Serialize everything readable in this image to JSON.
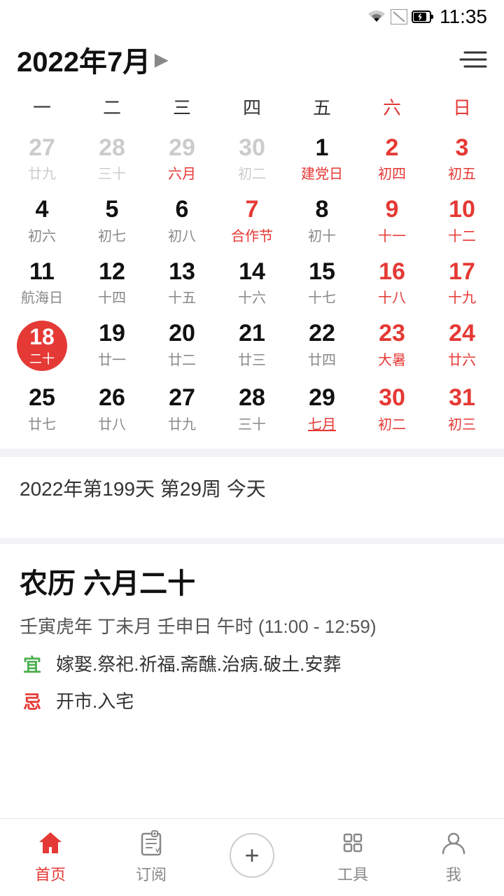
{
  "statusBar": {
    "time": "11:35"
  },
  "header": {
    "title": "2022年7月",
    "menuIcon": "menu-icon"
  },
  "calendar": {
    "weekdays": [
      {
        "label": "一",
        "type": "normal"
      },
      {
        "label": "二",
        "type": "normal"
      },
      {
        "label": "三",
        "type": "normal"
      },
      {
        "label": "四",
        "type": "normal"
      },
      {
        "label": "五",
        "type": "normal"
      },
      {
        "label": "六",
        "type": "sat"
      },
      {
        "label": "日",
        "type": "sun"
      }
    ],
    "weeks": [
      [
        {
          "num": "27",
          "sub": "廿九",
          "type": "prev-month"
        },
        {
          "num": "28",
          "sub": "三十",
          "type": "prev-month"
        },
        {
          "num": "29",
          "sub": "六月",
          "type": "prev-month red-sub"
        },
        {
          "num": "30",
          "sub": "初二",
          "type": "prev-month"
        },
        {
          "num": "1",
          "sub": "建党日",
          "type": "red-label"
        },
        {
          "num": "2",
          "sub": "初四",
          "type": "sat"
        },
        {
          "num": "3",
          "sub": "初五",
          "type": "sun"
        }
      ],
      [
        {
          "num": "4",
          "sub": "初六",
          "type": "normal"
        },
        {
          "num": "5",
          "sub": "初七",
          "type": "normal"
        },
        {
          "num": "6",
          "sub": "初八",
          "type": "normal"
        },
        {
          "num": "7",
          "sub": "合作节",
          "type": "red-full"
        },
        {
          "num": "8",
          "sub": "初十",
          "type": "normal"
        },
        {
          "num": "9",
          "sub": "十一",
          "type": "sat"
        },
        {
          "num": "10",
          "sub": "十二",
          "type": "sun"
        }
      ],
      [
        {
          "num": "11",
          "sub": "航海日",
          "type": "normal"
        },
        {
          "num": "12",
          "sub": "十四",
          "type": "normal"
        },
        {
          "num": "13",
          "sub": "十五",
          "type": "normal"
        },
        {
          "num": "14",
          "sub": "十六",
          "type": "normal"
        },
        {
          "num": "15",
          "sub": "十七",
          "type": "normal"
        },
        {
          "num": "16",
          "sub": "十八",
          "type": "sat"
        },
        {
          "num": "17",
          "sub": "十九",
          "type": "sun"
        }
      ],
      [
        {
          "num": "18",
          "sub": "二十",
          "type": "today"
        },
        {
          "num": "19",
          "sub": "廿一",
          "type": "normal"
        },
        {
          "num": "20",
          "sub": "廿二",
          "type": "normal"
        },
        {
          "num": "21",
          "sub": "廿三",
          "type": "normal"
        },
        {
          "num": "22",
          "sub": "廿四",
          "type": "normal"
        },
        {
          "num": "23",
          "sub": "大暑",
          "type": "sat red-full"
        },
        {
          "num": "24",
          "sub": "廿六",
          "type": "sun"
        }
      ],
      [
        {
          "num": "25",
          "sub": "廿七",
          "type": "normal"
        },
        {
          "num": "26",
          "sub": "廿八",
          "type": "normal"
        },
        {
          "num": "27",
          "sub": "廿九",
          "type": "normal"
        },
        {
          "num": "28",
          "sub": "三十",
          "type": "normal"
        },
        {
          "num": "29",
          "sub": "七月",
          "type": "red-label"
        },
        {
          "num": "30",
          "sub": "初二",
          "type": "sat"
        },
        {
          "num": "31",
          "sub": "初三",
          "type": "sun"
        }
      ]
    ]
  },
  "infoSection": {
    "dayDesc": "2022年第199天 第29周 今天"
  },
  "lunarSection": {
    "title": "农历 六月二十",
    "desc": "壬寅虎年 丁未月 壬申日 午时 (11:00 - 12:59)",
    "yi": {
      "label": "宜",
      "text": "嫁娶.祭祀.祈福.斋醮.治病.破土.安葬"
    },
    "ji": {
      "label": "忌",
      "text": "开市.入宅"
    }
  },
  "bottomNav": {
    "items": [
      {
        "label": "首页",
        "icon": "home-icon",
        "active": true
      },
      {
        "label": "订阅",
        "icon": "subscribe-icon",
        "active": false
      },
      {
        "label": "+",
        "icon": "add-icon",
        "active": false
      },
      {
        "label": "工具",
        "icon": "tools-icon",
        "active": false
      },
      {
        "label": "我",
        "icon": "profile-icon",
        "active": false
      }
    ]
  }
}
